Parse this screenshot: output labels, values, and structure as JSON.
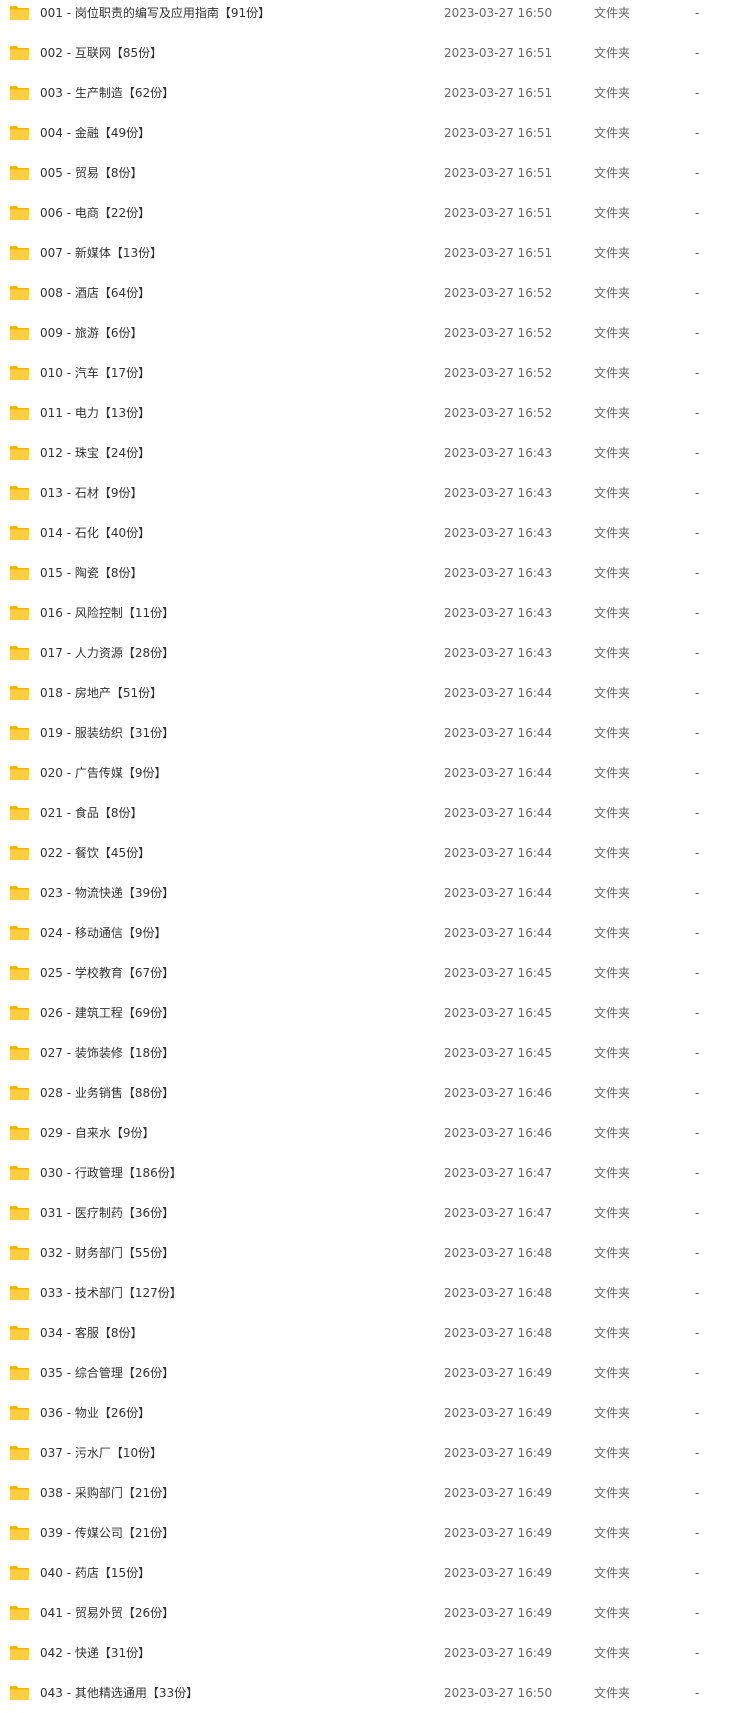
{
  "colors": {
    "folder_back": "#F5B400",
    "folder_front": "#FFCF3F",
    "text_primary": "#333333",
    "text_secondary": "#666666",
    "background": "#FFFFFF"
  },
  "icon": "folder-icon",
  "files": [
    {
      "name": "001 - 岗位职责的编写及应用指南【91份】",
      "date": "2023-03-27 16:50",
      "type": "文件夹",
      "size": "-"
    },
    {
      "name": "002 - 互联网【85份】",
      "date": "2023-03-27 16:51",
      "type": "文件夹",
      "size": "-"
    },
    {
      "name": "003 - 生产制造【62份】",
      "date": "2023-03-27 16:51",
      "type": "文件夹",
      "size": "-"
    },
    {
      "name": "004 - 金融【49份】",
      "date": "2023-03-27 16:51",
      "type": "文件夹",
      "size": "-"
    },
    {
      "name": "005 - 贸易【8份】",
      "date": "2023-03-27 16:51",
      "type": "文件夹",
      "size": "-"
    },
    {
      "name": "006 - 电商【22份】",
      "date": "2023-03-27 16:51",
      "type": "文件夹",
      "size": "-"
    },
    {
      "name": "007 - 新媒体【13份】",
      "date": "2023-03-27 16:51",
      "type": "文件夹",
      "size": "-"
    },
    {
      "name": "008 - 酒店【64份】",
      "date": "2023-03-27 16:52",
      "type": "文件夹",
      "size": "-"
    },
    {
      "name": "009 - 旅游【6份】",
      "date": "2023-03-27 16:52",
      "type": "文件夹",
      "size": "-"
    },
    {
      "name": "010 - 汽车【17份】",
      "date": "2023-03-27 16:52",
      "type": "文件夹",
      "size": "-"
    },
    {
      "name": "011 - 电力【13份】",
      "date": "2023-03-27 16:52",
      "type": "文件夹",
      "size": "-"
    },
    {
      "name": "012 - 珠宝【24份】",
      "date": "2023-03-27 16:43",
      "type": "文件夹",
      "size": "-"
    },
    {
      "name": "013 - 石材【9份】",
      "date": "2023-03-27 16:43",
      "type": "文件夹",
      "size": "-"
    },
    {
      "name": "014 - 石化【40份】",
      "date": "2023-03-27 16:43",
      "type": "文件夹",
      "size": "-"
    },
    {
      "name": "015 - 陶瓷【8份】",
      "date": "2023-03-27 16:43",
      "type": "文件夹",
      "size": "-"
    },
    {
      "name": "016 - 风险控制【11份】",
      "date": "2023-03-27 16:43",
      "type": "文件夹",
      "size": "-"
    },
    {
      "name": "017 - 人力资源【28份】",
      "date": "2023-03-27 16:43",
      "type": "文件夹",
      "size": "-"
    },
    {
      "name": "018 - 房地产【51份】",
      "date": "2023-03-27 16:44",
      "type": "文件夹",
      "size": "-"
    },
    {
      "name": "019 - 服装纺织【31份】",
      "date": "2023-03-27 16:44",
      "type": "文件夹",
      "size": "-"
    },
    {
      "name": "020 - 广告传媒【9份】",
      "date": "2023-03-27 16:44",
      "type": "文件夹",
      "size": "-"
    },
    {
      "name": "021 - 食品【8份】",
      "date": "2023-03-27 16:44",
      "type": "文件夹",
      "size": "-"
    },
    {
      "name": "022 - 餐饮【45份】",
      "date": "2023-03-27 16:44",
      "type": "文件夹",
      "size": "-"
    },
    {
      "name": "023 - 物流快递【39份】",
      "date": "2023-03-27 16:44",
      "type": "文件夹",
      "size": "-"
    },
    {
      "name": "024 - 移动通信【9份】",
      "date": "2023-03-27 16:44",
      "type": "文件夹",
      "size": "-"
    },
    {
      "name": "025 - 学校教育【67份】",
      "date": "2023-03-27 16:45",
      "type": "文件夹",
      "size": "-"
    },
    {
      "name": "026 - 建筑工程【69份】",
      "date": "2023-03-27 16:45",
      "type": "文件夹",
      "size": "-"
    },
    {
      "name": "027 - 装饰装修【18份】",
      "date": "2023-03-27 16:45",
      "type": "文件夹",
      "size": "-"
    },
    {
      "name": "028 - 业务销售【88份】",
      "date": "2023-03-27 16:46",
      "type": "文件夹",
      "size": "-"
    },
    {
      "name": "029 - 自来水【9份】",
      "date": "2023-03-27 16:46",
      "type": "文件夹",
      "size": "-"
    },
    {
      "name": "030 - 行政管理【186份】",
      "date": "2023-03-27 16:47",
      "type": "文件夹",
      "size": "-"
    },
    {
      "name": "031 - 医疗制药【36份】",
      "date": "2023-03-27 16:47",
      "type": "文件夹",
      "size": "-"
    },
    {
      "name": "032 - 财务部门【55份】",
      "date": "2023-03-27 16:48",
      "type": "文件夹",
      "size": "-"
    },
    {
      "name": "033 - 技术部门【127份】",
      "date": "2023-03-27 16:48",
      "type": "文件夹",
      "size": "-"
    },
    {
      "name": "034 - 客服【8份】",
      "date": "2023-03-27 16:48",
      "type": "文件夹",
      "size": "-"
    },
    {
      "name": "035 - 综合管理【26份】",
      "date": "2023-03-27 16:49",
      "type": "文件夹",
      "size": "-"
    },
    {
      "name": "036 - 物业【26份】",
      "date": "2023-03-27 16:49",
      "type": "文件夹",
      "size": "-"
    },
    {
      "name": "037 - 污水厂【10份】",
      "date": "2023-03-27 16:49",
      "type": "文件夹",
      "size": "-"
    },
    {
      "name": "038 - 采购部门【21份】",
      "date": "2023-03-27 16:49",
      "type": "文件夹",
      "size": "-"
    },
    {
      "name": "039 - 传媒公司【21份】",
      "date": "2023-03-27 16:49",
      "type": "文件夹",
      "size": "-"
    },
    {
      "name": "040 - 药店【15份】",
      "date": "2023-03-27 16:49",
      "type": "文件夹",
      "size": "-"
    },
    {
      "name": "041 - 贸易外贸【26份】",
      "date": "2023-03-27 16:49",
      "type": "文件夹",
      "size": "-"
    },
    {
      "name": "042 - 快递【31份】",
      "date": "2023-03-27 16:49",
      "type": "文件夹",
      "size": "-"
    },
    {
      "name": "043 - 其他精选通用【33份】",
      "date": "2023-03-27 16:50",
      "type": "文件夹",
      "size": "-"
    }
  ]
}
